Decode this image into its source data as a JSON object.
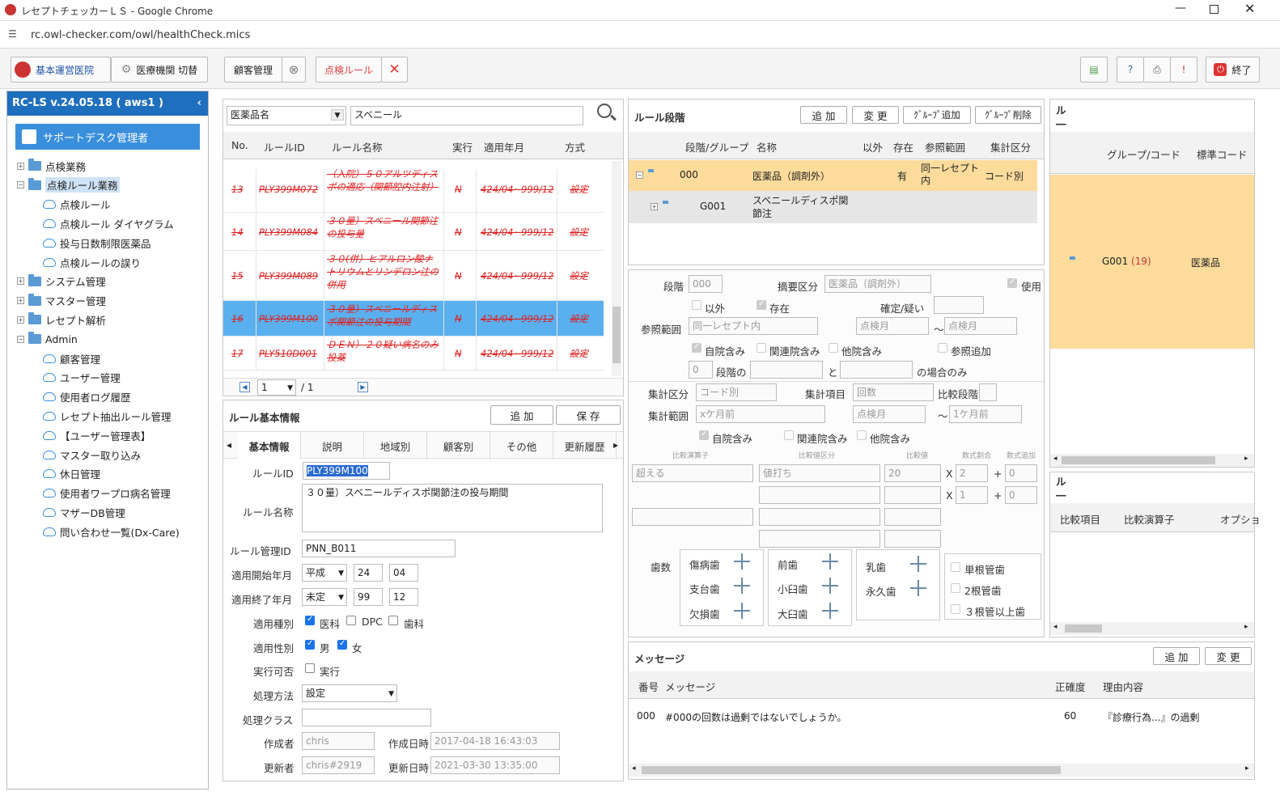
{
  "window": {
    "title": "レセプトチェッカーＬＳ - Google Chrome",
    "url": "rc.owl-checker.com/owl/healthCheck.mics"
  },
  "toolbar": {
    "clinic": "基本運営医院",
    "switch": "医療機関 切替",
    "customer": "顧客管理",
    "rule": "点検ルール",
    "exit": "終了"
  },
  "sidebar": {
    "version": "RC-LS v.24.05.18 ( aws1 )",
    "user": "サポートデスク管理者",
    "items": [
      {
        "label": "点検業務",
        "type": "folder",
        "level": 0,
        "expand": "+"
      },
      {
        "label": "点検ルール業務",
        "type": "folder",
        "level": 0,
        "expand": "−",
        "selected": true
      },
      {
        "label": "点検ルール",
        "type": "cloud",
        "level": 1
      },
      {
        "label": "点検ルール ダイヤグラム",
        "type": "cloud",
        "level": 1
      },
      {
        "label": "投与日数制限医薬品",
        "type": "cloud",
        "level": 1
      },
      {
        "label": "点検ルールの誤り",
        "type": "cloud",
        "level": 1
      },
      {
        "label": "システム管理",
        "type": "folder",
        "level": 0,
        "expand": "+"
      },
      {
        "label": "マスター管理",
        "type": "folder",
        "level": 0,
        "expand": "+"
      },
      {
        "label": "レセプト解析",
        "type": "folder",
        "level": 0,
        "expand": "+"
      },
      {
        "label": "Admin",
        "type": "folder",
        "level": 0,
        "expand": "−"
      },
      {
        "label": "顧客管理",
        "type": "cloud",
        "level": 1
      },
      {
        "label": "ユーザー管理",
        "type": "cloud",
        "level": 1
      },
      {
        "label": "使用者ログ履歴",
        "type": "cloud",
        "level": 1
      },
      {
        "label": "レセプト抽出ルール管理",
        "type": "cloud",
        "level": 1
      },
      {
        "label": "【ユーザー管理表】",
        "type": "cloud",
        "level": 1
      },
      {
        "label": "マスター取り込み",
        "type": "cloud",
        "level": 1
      },
      {
        "label": "休日管理",
        "type": "cloud",
        "level": 1
      },
      {
        "label": "使用者ワープロ病名管理",
        "type": "cloud",
        "level": 1
      },
      {
        "label": "マザーDB管理",
        "type": "cloud",
        "level": 1
      },
      {
        "label": "問い合わせ一覧(Dx-Care)",
        "type": "cloud",
        "level": 1
      }
    ]
  },
  "search": {
    "field": "医薬品名",
    "value": "スベニール"
  },
  "rulelist": {
    "headers": [
      "No.",
      "ルールID",
      "ルール名称",
      "実行",
      "適用年月",
      "方式"
    ],
    "rows": [
      {
        "no": "13",
        "id": "PLY399M072",
        "name": "（入院）５０アルツディスポの適応（関節腔内注射）",
        "exec": "N",
        "period": "424/04~999/12",
        "method": "設定",
        "selected": false
      },
      {
        "no": "14",
        "id": "PLY399M084",
        "name": "３０量）スベニール関節注の投与量",
        "exec": "N",
        "period": "424/04~999/12",
        "method": "設定",
        "selected": false
      },
      {
        "no": "15",
        "id": "PLY399M089",
        "name": "３０(併）ヒアルロン酸ナトリウムとリンデロン注の併用",
        "exec": "N",
        "period": "424/04~999/12",
        "method": "設定",
        "selected": false
      },
      {
        "no": "16",
        "id": "PLY399M100",
        "name": "３０量）スベニールディスポ関節注の投与期間",
        "exec": "N",
        "period": "424/04~999/12",
        "method": "設定",
        "selected": true
      },
      {
        "no": "17",
        "id": "PLY510D001",
        "name": "ＤＥＮ）２０疑い病名のみ投薬",
        "exec": "N",
        "period": "424/04~999/12",
        "method": "設定",
        "selected": false
      }
    ],
    "page": "1",
    "total": "/ 1"
  },
  "basic": {
    "title": "ルール基本情報",
    "add": "追 加",
    "save": "保 存",
    "tabs": [
      "基本情報",
      "説明",
      "地域別",
      "顧客別",
      "その他",
      "更新履歴"
    ],
    "rule_id_label": "ルールID",
    "rule_id": "PLY399M100",
    "rule_name_label": "ルール名称",
    "rule_name": "３０量）スベニールディスポ関節注の投与期間",
    "mgmt_label": "ルール管理ID",
    "mgmt_id": "PNN_B011",
    "start_label": "適用開始年月",
    "start_era": "平成",
    "start_y": "24",
    "start_m": "04",
    "end_label": "適用終了年月",
    "end_era": "未定",
    "end_y": "99",
    "end_m": "12",
    "type_label": "適用種別",
    "type_med": "医科",
    "type_dpc": "DPC",
    "type_dent": "歯科",
    "sex_label": "適用性別",
    "male": "男",
    "female": "女",
    "exec_label": "実行可否",
    "exec": "実行",
    "method_label": "処理方法",
    "method": "設定",
    "class_label": "処理クラス",
    "class": "",
    "creator_label": "作成者",
    "creator": "chris",
    "created_label": "作成日時",
    "created": "2017-04-18 16:43:03",
    "updater_label": "更新者",
    "updater": "chris#2919",
    "updated_label": "更新日時",
    "updated": "2021-03-30 13:35:00"
  },
  "stage": {
    "title": "ルール段階",
    "add": "追 加",
    "change": "変 更",
    "grp_add": "ｸﾞﾙｰﾌﾟ追加",
    "grp_del": "ｸﾞﾙｰﾌﾟ削除",
    "headers": [
      "段階/グループ",
      "名称",
      "以外",
      "存在",
      "参照範囲",
      "集計区分"
    ],
    "rows": [
      {
        "code": "000",
        "name": "医薬品（調剤外）",
        "except": "",
        "exist": "有",
        "range": "同一レセプト内",
        "agg": "コード別"
      },
      {
        "code": "G001",
        "name": "スベニールディスポ関節注",
        "except": "",
        "exist": "",
        "range": "",
        "agg": ""
      }
    ]
  },
  "detail": {
    "stage_label": "段階",
    "stage": "000",
    "tekiyo_label": "摘要区分",
    "tekiyo": "医薬品（調剤外）",
    "use": "使用",
    "except": "以外",
    "exist": "存在",
    "kakutei_label": "確定/疑い",
    "range_label": "参照範囲",
    "range": "同一レセプト内",
    "from": "点検月",
    "tilde": "～",
    "to": "点検月",
    "self": "自院含み",
    "related": "関連院含み",
    "other": "他院含み",
    "refadd": "参照追加",
    "stage_num": "0",
    "stage_of": "段階の",
    "and": "と",
    "only": "の場合のみ",
    "agg_label": "集計区分",
    "agg": "コード別",
    "item_label": "集計項目",
    "item": "回数",
    "cmp_stage": "比較段階",
    "agg_range_label": "集計範囲",
    "agg_range": "xケ月前",
    "agg_from": "点検月",
    "agg_to": "1ケ月前",
    "op_h": "比較演算子",
    "valtype_h": "比較値区分",
    "val_h": "比較値",
    "mul_h": "数式割合",
    "add_h": "数式追加",
    "op": "超える",
    "valtype": "値打ち",
    "val": "20",
    "x": "X",
    "mul1": "2",
    "plus": "+",
    "add1": "0",
    "mul2": "1",
    "add2": "0",
    "teeth_label": "歯数",
    "t1": "傷病歯",
    "t2": "支台歯",
    "t3": "欠損歯",
    "t4": "前歯",
    "t5": "小臼歯",
    "t6": "大臼歯",
    "t7": "乳歯",
    "t8": "永久歯",
    "r1": "単根管歯",
    "r2": "2根管歯",
    "r3": "３根管以上歯"
  },
  "right": {
    "title": "ル\n―",
    "headers": [
      "グループ/コード",
      "標準コード"
    ],
    "code": "G001",
    "count": "(19)",
    "std": "医薬品",
    "title2": "ル\n―",
    "headers2": [
      "比較項目",
      "比較演算子",
      "オプショ"
    ]
  },
  "message": {
    "title": "メッセージ",
    "add": "追 加",
    "change": "変 更",
    "headers": [
      "番号",
      "メッセージ",
      "正確度",
      "理由内容"
    ],
    "rows": [
      {
        "no": "000",
        "msg": "#000の回数は過剰ではないでしょうか。",
        "acc": "60",
        "reason": "『診療行為...』の過剰"
      }
    ]
  }
}
